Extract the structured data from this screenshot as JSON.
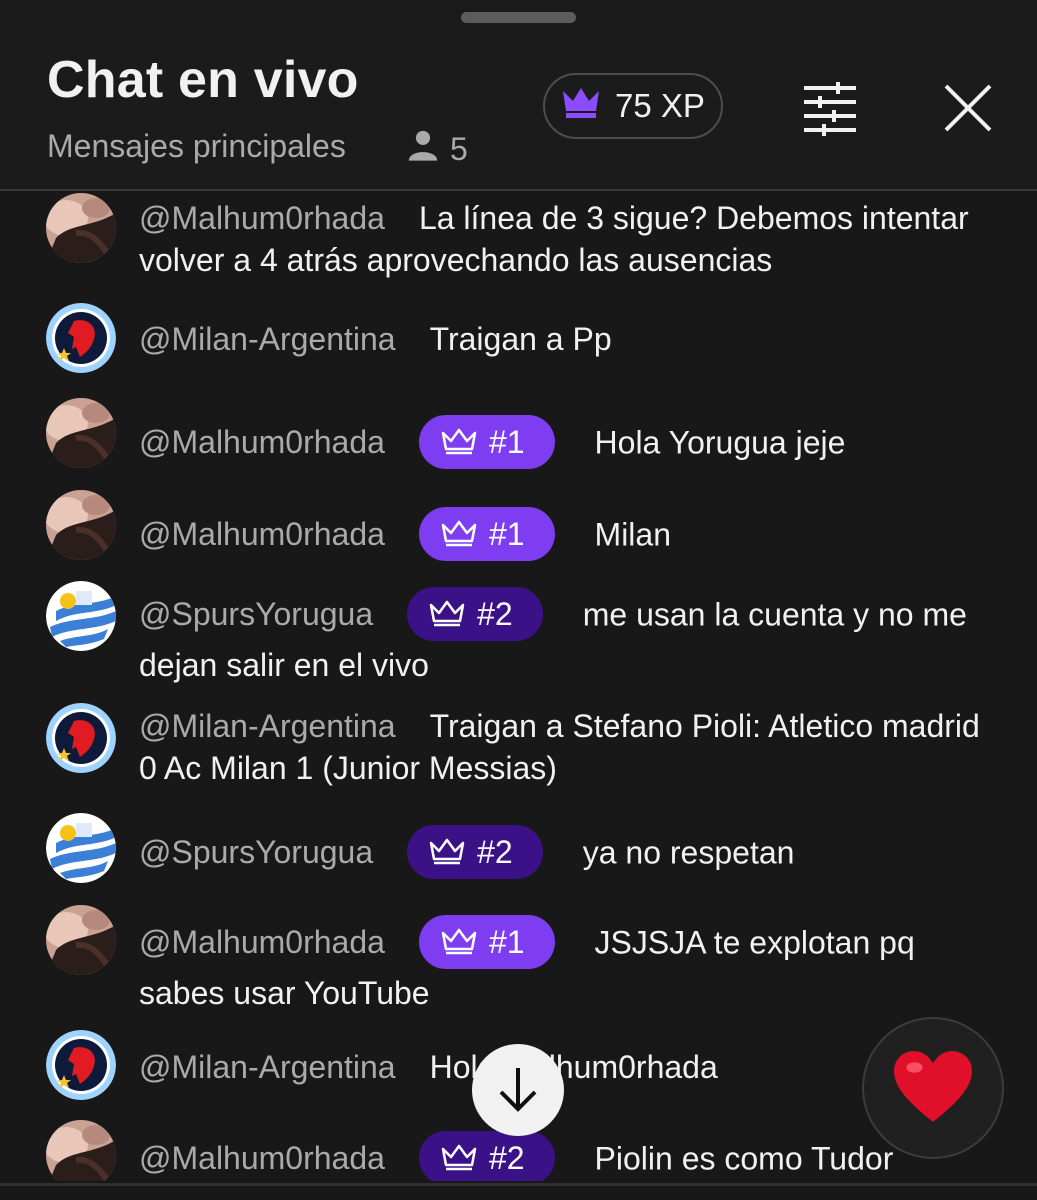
{
  "header": {
    "title": "Chat en vivo",
    "subtitle": "Mensajes principales",
    "viewer_count": "5",
    "xp_label": "75 XP",
    "icons": [
      "person-icon",
      "crown-icon",
      "filter-sliders-icon",
      "close-icon"
    ]
  },
  "colors": {
    "rank1_badge": "#7e3df0",
    "rank2_badge": "#3b1188",
    "author_text": "#aaaaaa",
    "heart": "#e0102b"
  },
  "messages": [
    {
      "author": "@Malhum0rhada",
      "avatar": "photo-avatar",
      "badge": "",
      "text": "La línea de 3 sigue? Debemos intentar volver a 4 atrás aprovechando las ausencias"
    },
    {
      "author": "@Milan-Argentina",
      "avatar": "milan-argentina-logo",
      "badge": "",
      "text": "Traigan a Pp"
    },
    {
      "author": "@Malhum0rhada",
      "avatar": "photo-avatar",
      "badge": "#1",
      "text": "Hola Yorugua jeje"
    },
    {
      "author": "@Malhum0rhada",
      "avatar": "photo-avatar",
      "badge": "#1",
      "text": "Milan"
    },
    {
      "author": "@SpursYorugua",
      "avatar": "uruguay-flag-avatar",
      "badge": "#2",
      "text": "me usan la cuenta y no me dejan salir en el vivo"
    },
    {
      "author": "@Milan-Argentina",
      "avatar": "milan-argentina-logo",
      "badge": "",
      "text": "Traigan a Stefano Pioli: Atletico madrid 0 Ac Milan 1 (Junior Messias)"
    },
    {
      "author": "@SpursYorugua",
      "avatar": "uruguay-flag-avatar",
      "badge": "#2",
      "text": "ya no respetan"
    },
    {
      "author": "@Malhum0rhada",
      "avatar": "photo-avatar",
      "badge": "#1",
      "text": "JSJSJA te explotan pq sabes usar YouTube"
    },
    {
      "author": "@Milan-Argentina",
      "avatar": "milan-argentina-logo",
      "badge": "",
      "text": "Hola Malhum0rhada"
    },
    {
      "author": "@Malhum0rhada",
      "avatar": "photo-avatar",
      "badge": "#2",
      "text": "Piolin es como Tudor"
    }
  ],
  "controls": {
    "scroll_down_icon": "arrow-down-icon",
    "reaction_icon": "heart-icon"
  }
}
